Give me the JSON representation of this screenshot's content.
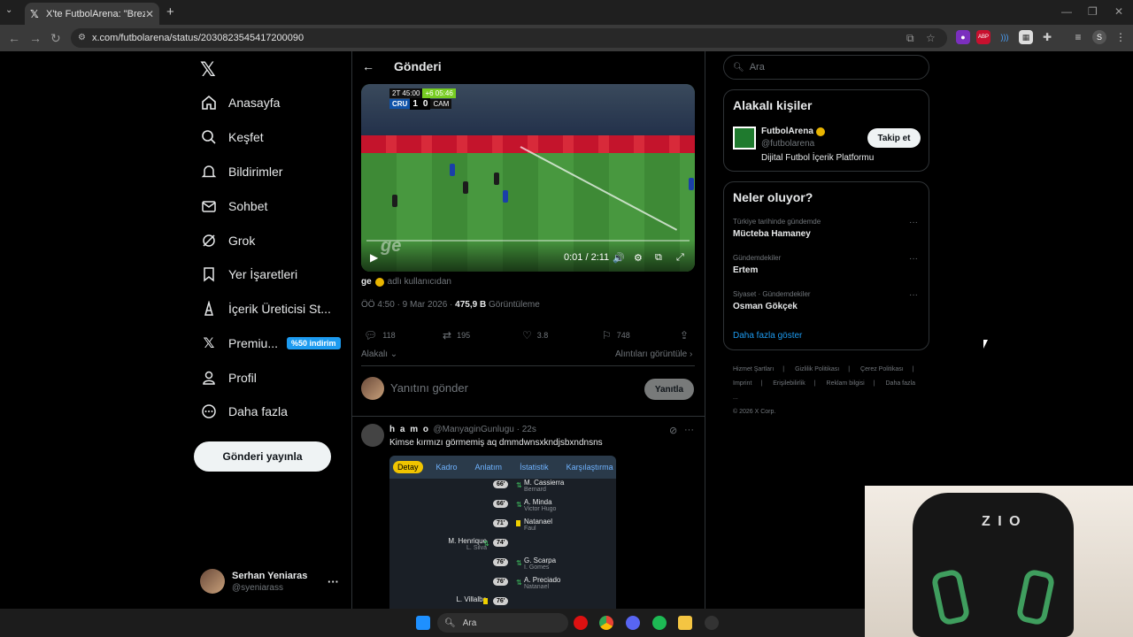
{
  "browser": {
    "tab_title": "X'te FutbolArena: \"Brezilya'da Cr",
    "url": "x.com/futbolarena/status/2030823545417200090"
  },
  "sidebar": {
    "items": [
      {
        "label": "Anasayfa",
        "icon": "home-icon"
      },
      {
        "label": "Keşfet",
        "icon": "search-icon"
      },
      {
        "label": "Bildirimler",
        "icon": "bell-icon"
      },
      {
        "label": "Sohbet",
        "icon": "mail-icon"
      },
      {
        "label": "Grok",
        "icon": "grok-icon"
      },
      {
        "label": "Yer İşaretleri",
        "icon": "bookmark-icon"
      },
      {
        "label": "İçerik Üreticisi St...",
        "icon": "creator-icon"
      },
      {
        "label": "Premiu...",
        "icon": "x-premium-icon",
        "badge": "%50 indirim"
      },
      {
        "label": "Profil",
        "icon": "profile-icon"
      },
      {
        "label": "Daha fazla",
        "icon": "more-circle-icon"
      }
    ],
    "post_button": "Gönderi yayınla",
    "account": {
      "name": "Serhan Yeniaras",
      "handle": "@syeniarass"
    }
  },
  "post": {
    "header": "Gönderi",
    "video": {
      "time": "0:01 / 2:11",
      "score_clock": "2T 45:00",
      "added_time": "+6 05:46",
      "home_team": "CRU",
      "home_score": "1",
      "away_score": "0",
      "away_team": "CAM",
      "watermark": "ge"
    },
    "source_name": "ge",
    "source_suffix": "adlı kullanıcıdan",
    "time": "ÖÖ 4:50 · 9 Mar 2026 · ",
    "views": "475,9 B",
    "views_label": " Görüntüleme",
    "replies": "118",
    "reposts": "195",
    "likes": "3.8",
    "bookmarks": "748",
    "relevant": "Alakalı",
    "quotes": "Alıntıları görüntüle",
    "reply_placeholder": "Yanıtını gönder",
    "reply_button": "Yanıtla"
  },
  "reply": {
    "name": "h a m o",
    "handle": "@ManyaginGunlugu · 22s",
    "text": "Kimse kırmızı görmemiş aq dmmdwnsxkndjsbxndnsns",
    "tabs": [
      "Detay",
      "Kadro",
      "Anlatım",
      "İstatistik",
      "Karşılaştırma"
    ],
    "events": [
      {
        "minute": "66'",
        "name": "M. Cassierra",
        "sub": "Bernard",
        "side": "right",
        "kind": "sub"
      },
      {
        "minute": "66'",
        "name": "A. Minda",
        "sub": "Victor Hugo",
        "side": "right",
        "kind": "sub"
      },
      {
        "minute": "71'",
        "name": "Natanael",
        "sub": "Faul",
        "side": "right",
        "kind": "yellow"
      },
      {
        "minute": "74'",
        "name": "M. Henrique",
        "sub": "L. Silva",
        "side": "left",
        "kind": "sub"
      },
      {
        "minute": "76'",
        "name": "G. Scarpa",
        "sub": "I. Gomes",
        "side": "right",
        "kind": "sub"
      },
      {
        "minute": "76'",
        "name": "A. Preciado",
        "sub": "Natanael",
        "side": "right",
        "kind": "sub"
      },
      {
        "minute": "76'",
        "name": "L. Villalba",
        "sub": "",
        "side": "left",
        "kind": "yellow"
      }
    ]
  },
  "right": {
    "search_placeholder": "Ara",
    "related_title": "Alakalı kişiler",
    "account": {
      "name": "FutbolArena",
      "handle": "@futbolarena",
      "bio": "Dijital Futbol İçerik Platformu",
      "follow": "Takip et"
    },
    "trends_title": "Neler oluyor?",
    "trends": [
      {
        "context": "Türkiye tarihinde gündemde",
        "name": "Mücteba Hamaney"
      },
      {
        "context": "Gündemdekiler",
        "name": "Ertem"
      },
      {
        "context": "Siyaset · Gündemdekiler",
        "name": "Osman Gökçek"
      }
    ],
    "show_more": "Daha fazla göster",
    "footer": [
      "Hizmet Şartları",
      "Gizlilik Politikası",
      "Çerez Politikası",
      "Imprint",
      "Erişilebilirlik",
      "Reklam bilgisi",
      "Daha fazla ...",
      "© 2026 X Corp."
    ]
  },
  "taskbar": {
    "search": "Ara"
  },
  "colors": {
    "accent": "#1d9bf0",
    "verified": "#e8b400",
    "bg": "#000000"
  }
}
